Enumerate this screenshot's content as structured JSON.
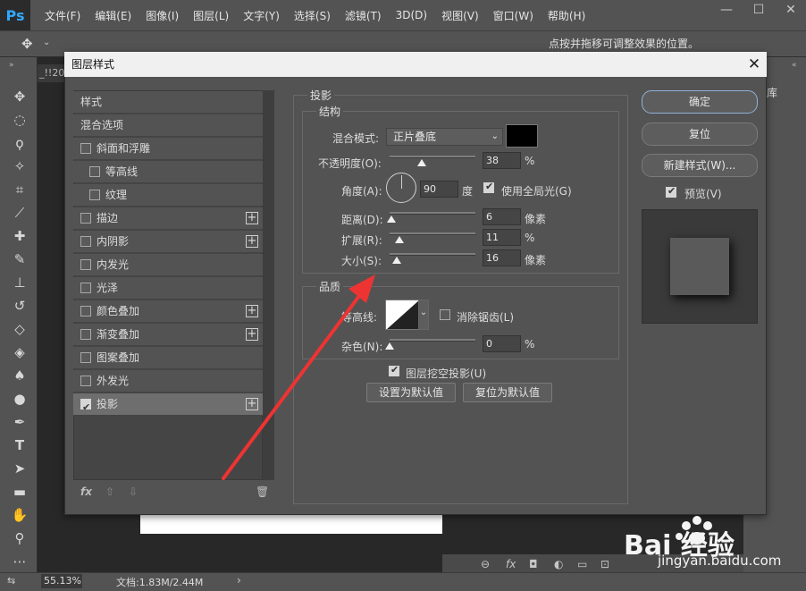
{
  "app": {
    "logo": "Ps"
  },
  "menu": [
    "文件(F)",
    "编辑(E)",
    "图像(I)",
    "图层(L)",
    "文字(Y)",
    "选择(S)",
    "滤镜(T)",
    "3D(D)",
    "视图(V)",
    "窗口(W)",
    "帮助(H)"
  ],
  "window_controls": {
    "minimize": "—",
    "maximize": "☐",
    "close": "✕"
  },
  "options_bar": {
    "hint": "点按并拖移可调整效果的位置。"
  },
  "doc_tab": "_!!20",
  "right_panel": {
    "library": "库"
  },
  "status": {
    "zoom": "55.13%",
    "doc": "文档:1.83M/2.44M",
    "arrow": "›"
  },
  "dialog": {
    "title": "图层样式",
    "close": "✕",
    "styles_header": "样式",
    "blend_options": "混合选项",
    "items": [
      {
        "label": "斜面和浮雕",
        "checked": false,
        "indent": false,
        "plus": false
      },
      {
        "label": "等高线",
        "checked": false,
        "indent": true,
        "plus": false
      },
      {
        "label": "纹理",
        "checked": false,
        "indent": true,
        "plus": false
      },
      {
        "label": "描边",
        "checked": false,
        "indent": false,
        "plus": true
      },
      {
        "label": "内阴影",
        "checked": false,
        "indent": false,
        "plus": true
      },
      {
        "label": "内发光",
        "checked": false,
        "indent": false,
        "plus": false
      },
      {
        "label": "光泽",
        "checked": false,
        "indent": false,
        "plus": false
      },
      {
        "label": "颜色叠加",
        "checked": false,
        "indent": false,
        "plus": true
      },
      {
        "label": "渐变叠加",
        "checked": false,
        "indent": false,
        "plus": true
      },
      {
        "label": "图案叠加",
        "checked": false,
        "indent": false,
        "plus": false
      },
      {
        "label": "外发光",
        "checked": false,
        "indent": false,
        "plus": false
      },
      {
        "label": "投影",
        "checked": true,
        "indent": false,
        "plus": true,
        "selected": true
      }
    ],
    "list_footer": {
      "fx": "fx",
      "up": "⇧",
      "down": "⇩",
      "trash": "🗑"
    },
    "drop_shadow": {
      "title": "投影",
      "structure": {
        "title": "结构",
        "blend_mode_label": "混合模式:",
        "blend_mode_value": "正片叠底",
        "shadow_color": "#000000",
        "opacity_label": "不透明度(O):",
        "opacity_value": "38",
        "opacity_fraction": 0.38,
        "opacity_unit": "%",
        "angle_label": "角度(A):",
        "angle_value": "90",
        "angle_unit": "度",
        "global_light_label": "使用全局光(G)",
        "global_light_checked": true,
        "distance_label": "距离(D):",
        "distance_value": "6",
        "distance_unit": "像素",
        "distance_fraction": 0.02,
        "spread_label": "扩展(R):",
        "spread_value": "11",
        "spread_unit": "%",
        "spread_fraction": 0.11,
        "size_label": "大小(S):",
        "size_value": "16",
        "size_unit": "像素",
        "size_fraction": 0.08
      },
      "quality": {
        "title": "品质",
        "contour_label": "等高线:",
        "antialias_label": "消除锯齿(L)",
        "antialias_checked": false,
        "noise_label": "杂色(N):",
        "noise_value": "0",
        "noise_unit": "%",
        "noise_fraction": 0.0
      },
      "knockout_label": "图层挖空投影(U)",
      "knockout_checked": true,
      "set_default": "设置为默认值",
      "reset_default": "复位为默认值"
    },
    "buttons": {
      "ok": "确定",
      "reset": "复位",
      "new_style": "新建样式(W)...",
      "preview": "预览(V)",
      "preview_checked": true
    }
  },
  "watermark": {
    "text": "Bai  经验",
    "url": "jingyan.baidu.com"
  }
}
